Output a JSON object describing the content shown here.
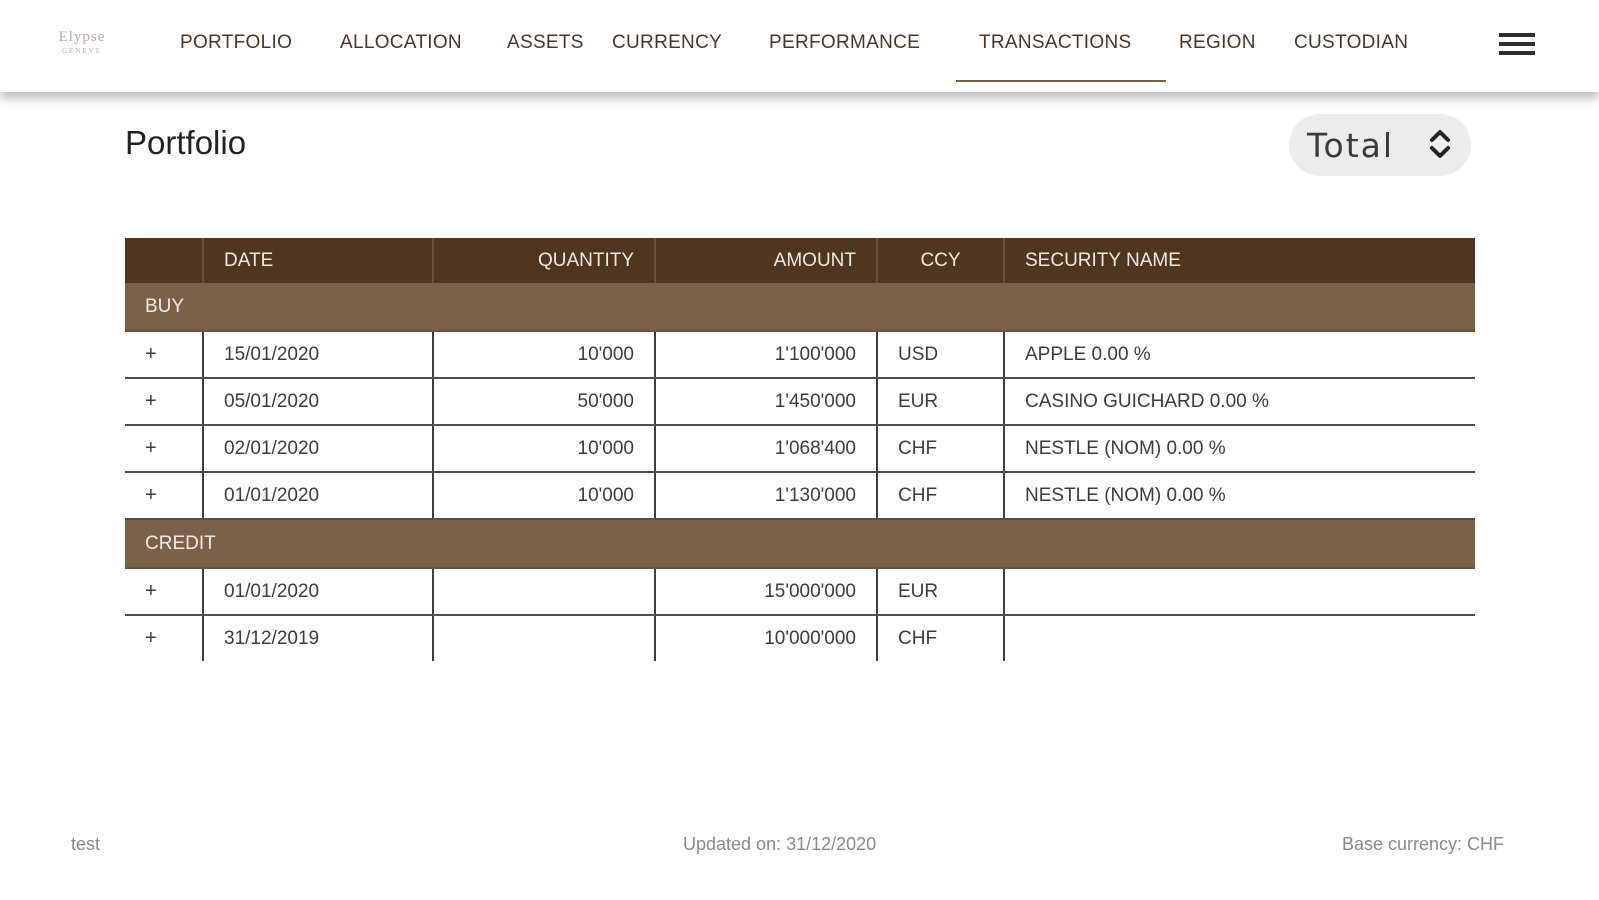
{
  "logo": {
    "line1": "Elypse",
    "line2": "GENEVE"
  },
  "nav": {
    "items": [
      {
        "label": "PORTFOLIO"
      },
      {
        "label": "ALLOCATION"
      },
      {
        "label": "ASSETS"
      },
      {
        "label": "CURRENCY"
      },
      {
        "label": "PERFORMANCE"
      },
      {
        "label": "TRANSACTIONS",
        "active": true
      },
      {
        "label": "REGION"
      },
      {
        "label": "CUSTODIAN"
      }
    ],
    "menu_icon": "hamburger-menu-icon"
  },
  "page": {
    "title": "Portfolio"
  },
  "selector": {
    "value": "Total",
    "icon": "up-down-chevron-icon"
  },
  "table": {
    "headers": [
      "",
      "DATE",
      "QUANTITY",
      "AMOUNT",
      "CCY",
      "SECURITY NAME"
    ],
    "groups": [
      {
        "label": "BUY",
        "rows": [
          {
            "expander": "+",
            "date": "15/01/2020",
            "quantity": "10'000",
            "amount": "1'100'000",
            "ccy": "USD",
            "security": "APPLE 0.00 %"
          },
          {
            "expander": "+",
            "date": "05/01/2020",
            "quantity": "50'000",
            "amount": "1'450'000",
            "ccy": "EUR",
            "security": "CASINO GUICHARD 0.00 %"
          },
          {
            "expander": "+",
            "date": "02/01/2020",
            "quantity": "10'000",
            "amount": "1'068'400",
            "ccy": "CHF",
            "security": "NESTLE (NOM) 0.00 %"
          },
          {
            "expander": "+",
            "date": "01/01/2020",
            "quantity": "10'000",
            "amount": "1'130'000",
            "ccy": "CHF",
            "security": "NESTLE (NOM) 0.00 %"
          }
        ]
      },
      {
        "label": "CREDIT",
        "rows": [
          {
            "expander": "+",
            "date": "01/01/2020",
            "quantity": "",
            "amount": "15'000'000",
            "ccy": "EUR",
            "security": ""
          },
          {
            "expander": "+",
            "date": "31/12/2019",
            "quantity": "",
            "amount": "10'000'000",
            "ccy": "CHF",
            "security": ""
          }
        ]
      }
    ]
  },
  "footer": {
    "left": "test",
    "center": "Updated on: 31/12/2020",
    "right": "Base currency: CHF"
  },
  "colors": {
    "header_bg": "#4e3620",
    "group_bg": "#7a6248",
    "nav_text": "#4a3626",
    "active_underline": "#7a5e44"
  }
}
